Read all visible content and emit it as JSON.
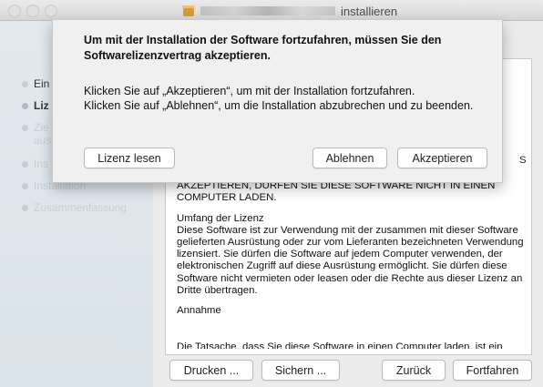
{
  "window": {
    "title_suffix": "installieren",
    "icon": "package-icon"
  },
  "sidebar": {
    "items": [
      {
        "label": "Ein",
        "state": "done"
      },
      {
        "label": "Liz",
        "state": "active"
      },
      {
        "label": "Zie",
        "state": "pending"
      },
      {
        "label": "aus",
        "state": "pending"
      },
      {
        "label": "Ins",
        "state": "pending"
      },
      {
        "label": "Installation",
        "state": "pending"
      },
      {
        "label": "Zusammenfassung",
        "state": "pending"
      }
    ]
  },
  "license": {
    "overflow_fragment": "S",
    "para1": "SIE DIE REGELUNGEN DIESER VEREINBARUNG NICHT AKZEPTIEREN, DÜRFEN SIE DIESE SOFTWARE NICHT IN EINEN COMPUTER LADEN.",
    "heading2": "Umfang der Lizenz",
    "para2": "Diese Software ist zur Verwendung mit der zusammen mit dieser Software gelieferten Ausrüstung oder zur vom Lieferanten bezeichneten Verwendung lizensiert. Sie dürfen die Software auf jedem Computer verwenden, der elektronischen Zugriff auf diese Ausrüstung ermöglicht. Sie dürfen diese Software nicht vermieten oder leasen oder die Rechte aus dieser Lizenz an Dritte übertragen.",
    "heading3": "Annahme",
    "cut_line": "Die Tatsache, dass Sie diese Software in einen Computer laden, ist ein Zeichen"
  },
  "buttons": {
    "print": "Drucken ...",
    "save": "Sichern ...",
    "back": "Zurück",
    "continue": "Fortfahren"
  },
  "sheet": {
    "title": "Um mit der Installation der Software fortzufahren, müssen Sie den Softwarelizenzvertrag akzeptieren.",
    "line1": "Klicken Sie auf „Akzeptieren“, um mit der Installation fortzufahren.",
    "line2": "Klicken Sie auf „Ablehnen“, um die Installation abzubrechen und zu beenden.",
    "read_license": "Lizenz lesen",
    "decline": "Ablehnen",
    "accept": "Akzeptieren"
  }
}
